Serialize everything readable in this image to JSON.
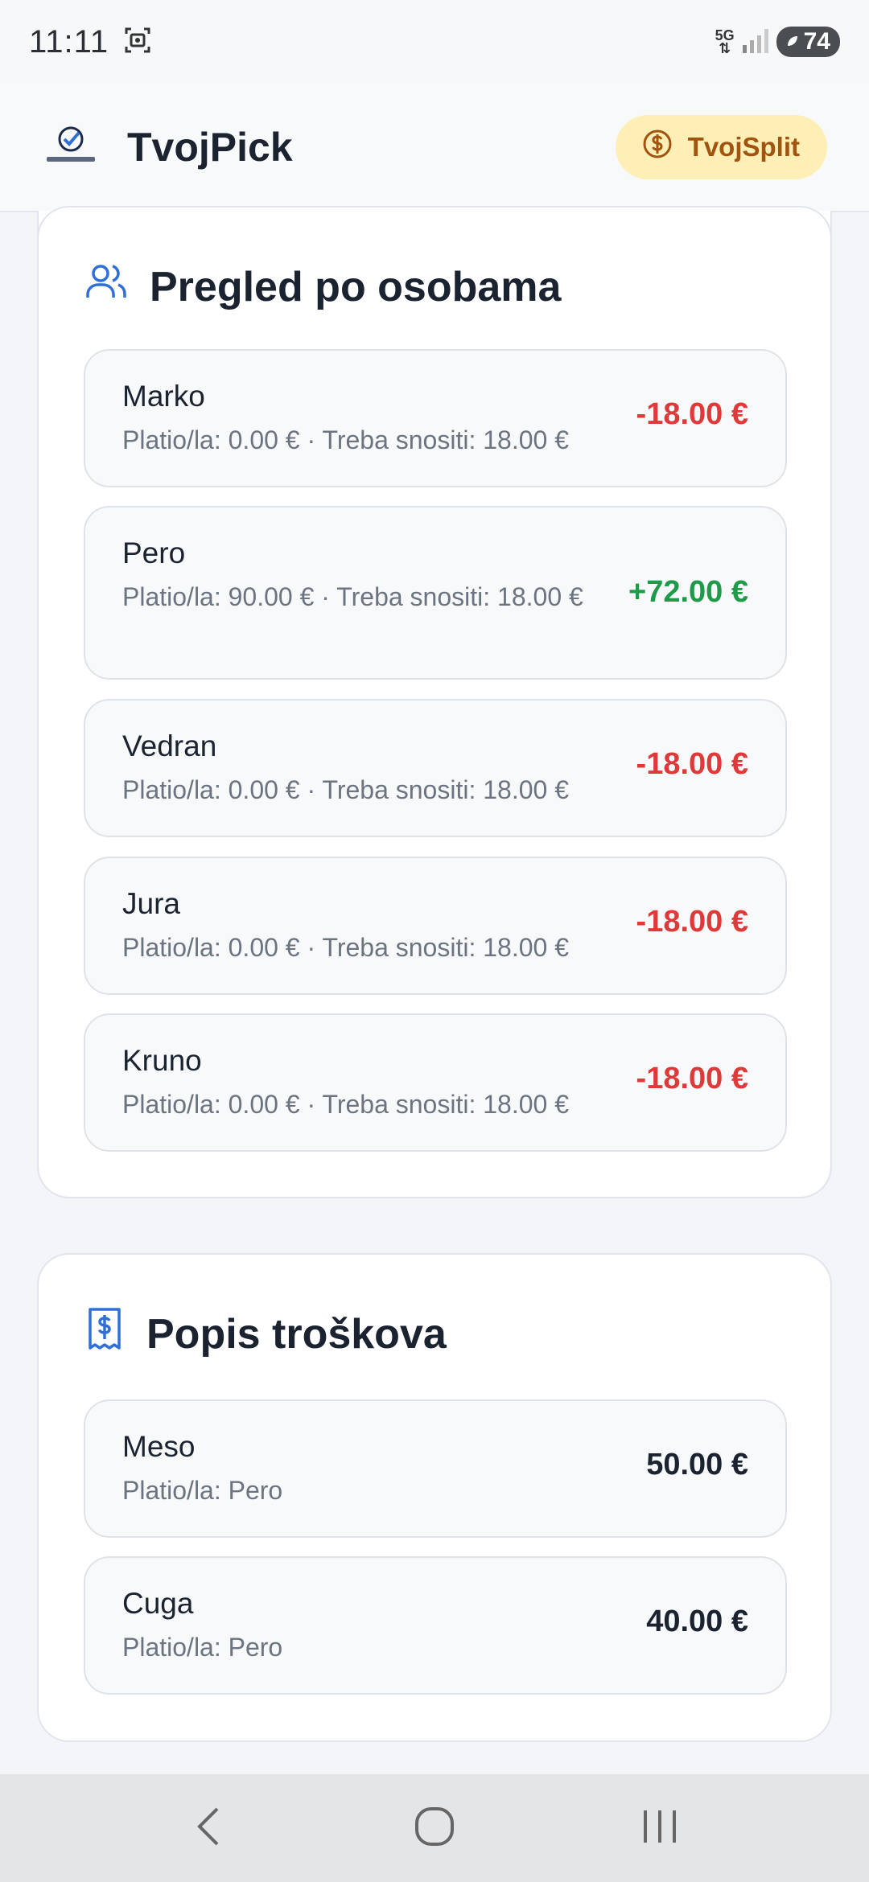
{
  "status_bar": {
    "time": "11:11",
    "network": "5G",
    "battery": "74"
  },
  "header": {
    "app_title": "TvojPick",
    "split_button_label": "TvojSplit"
  },
  "people_card": {
    "title": "Pregled po osobama",
    "people": [
      {
        "name": "Marko",
        "sub": "Platio/la: 0.00 € · Treba snositi: 18.00 €",
        "amount": "-18.00 €",
        "sign": "negative"
      },
      {
        "name": "Pero",
        "sub": "Platio/la: 90.00 € · Treba snositi: 18.00 €",
        "amount": "+72.00 €",
        "sign": "positive"
      },
      {
        "name": "Vedran",
        "sub": "Platio/la: 0.00 € · Treba snositi: 18.00 €",
        "amount": "-18.00 €",
        "sign": "negative"
      },
      {
        "name": "Jura",
        "sub": "Platio/la: 0.00 € · Treba snositi: 18.00 €",
        "amount": "-18.00 €",
        "sign": "negative"
      },
      {
        "name": "Kruno",
        "sub": "Platio/la: 0.00 € · Treba snositi: 18.00 €",
        "amount": "-18.00 €",
        "sign": "negative"
      }
    ]
  },
  "expenses_card": {
    "title": "Popis troškova",
    "expenses": [
      {
        "name": "Meso",
        "sub": "Platio/la: Pero",
        "amount": "50.00 €"
      },
      {
        "name": "Cuga",
        "sub": "Platio/la: Pero",
        "amount": "40.00 €"
      }
    ]
  },
  "colors": {
    "negative": "#df3a3a",
    "positive": "#1f9a48",
    "accent_blue": "#2f6fd6",
    "split_button_bg": "#fdefb5",
    "split_button_text": "#a1530f"
  },
  "icons": {
    "people_card": "users-icon",
    "expenses_card": "receipt-dollar-icon",
    "split_button": "dollar-circle-icon",
    "nav": [
      "back-icon",
      "home-icon",
      "recents-icon"
    ]
  }
}
